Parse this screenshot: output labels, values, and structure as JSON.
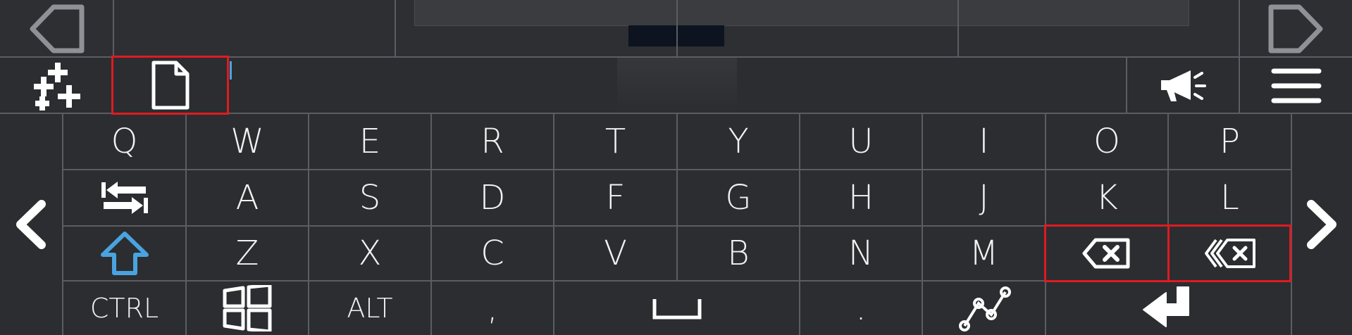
{
  "top_bar": {
    "prev_arrow_icon": "left-outline-arrow",
    "next_arrow_icon": "right-outline-arrow"
  },
  "toolbar": {
    "add_icon": "multi-plus-icon",
    "file_icon": "document-icon",
    "announce_icon": "megaphone-icon",
    "menu_icon": "hamburger-menu-icon"
  },
  "keyboard": {
    "row1": [
      "Q",
      "W",
      "E",
      "R",
      "T",
      "Y",
      "U",
      "I",
      "O",
      "P"
    ],
    "row2": [
      "A",
      "S",
      "D",
      "F",
      "G",
      "H",
      "J",
      "K",
      "L"
    ],
    "row3": [
      "Z",
      "X",
      "C",
      "V",
      "B",
      "N",
      "M"
    ],
    "ctrl": "CTRL",
    "alt": "ALT",
    "comma": ",",
    "period": ".",
    "shift_color": "#4aa3df",
    "highlight_color": "#e01a22"
  }
}
